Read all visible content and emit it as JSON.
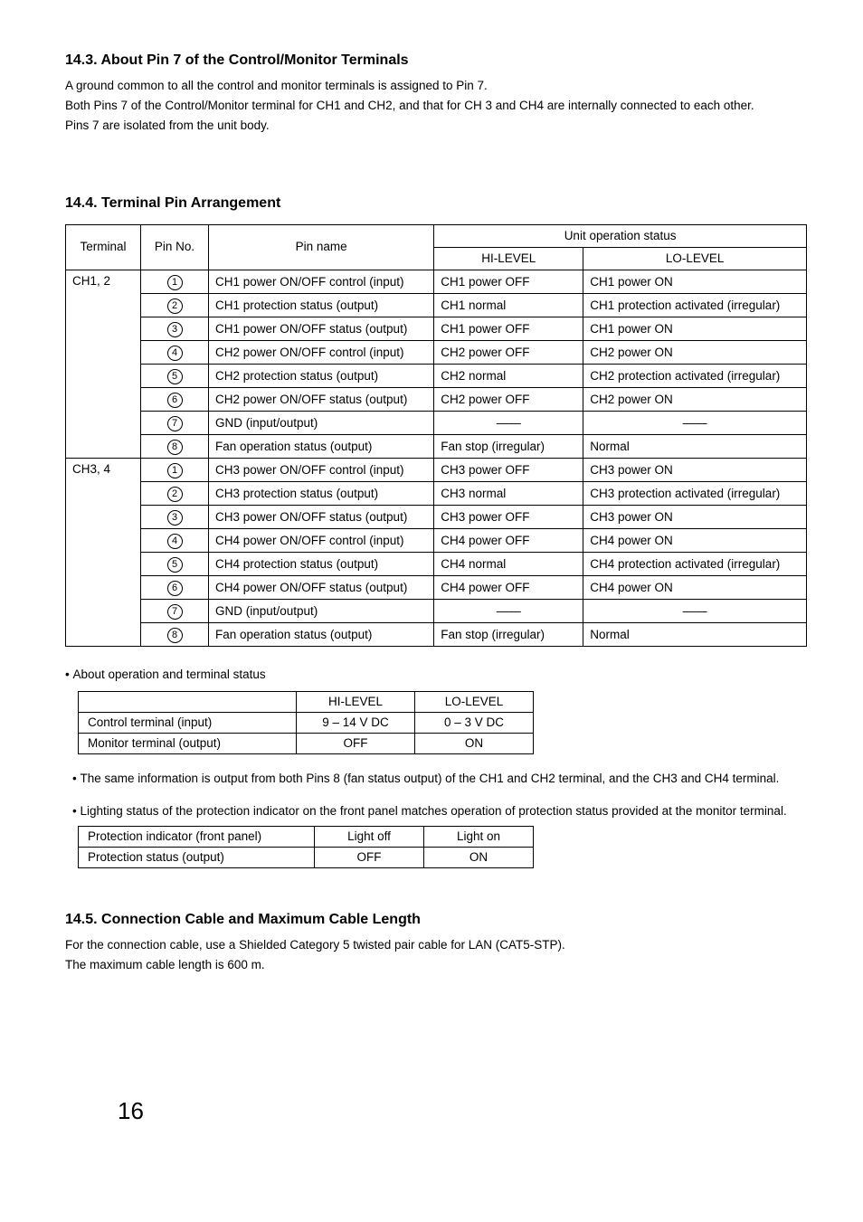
{
  "s1": {
    "heading": "14.3. About Pin 7 of the Control/Monitor Terminals",
    "p1": "A ground common to all the control and monitor terminals is assigned to Pin 7.",
    "p2": "Both Pins 7 of the Control/Monitor terminal for CH1 and CH2, and that for CH 3 and CH4 are internally connected to each other.",
    "p3": "Pins 7 are isolated from the unit body."
  },
  "s2": {
    "heading": "14.4. Terminal Pin Arrangement",
    "hdr": {
      "terminal": "Terminal",
      "pinno": "Pin No.",
      "pinname": "Pin name",
      "status": "Unit operation status",
      "hi": "HI-LEVEL",
      "lo": "LO-LEVEL"
    },
    "g1": "CH1, 2",
    "g2": "CH3, 4",
    "rows1": [
      {
        "n": "1",
        "name": "CH1 power ON/OFF control (input)",
        "hi": "CH1 power OFF",
        "lo": "CH1 power ON"
      },
      {
        "n": "2",
        "name": "CH1 protection status (output)",
        "hi": "CH1 normal",
        "lo": "CH1 protection activated (irregular)"
      },
      {
        "n": "3",
        "name": "CH1 power ON/OFF status (output)",
        "hi": "CH1 power OFF",
        "lo": "CH1 power ON"
      },
      {
        "n": "4",
        "name": "CH2 power ON/OFF control (input)",
        "hi": "CH2 power OFF",
        "lo": "CH2 power ON"
      },
      {
        "n": "5",
        "name": "CH2 protection status (output)",
        "hi": "CH2 normal",
        "lo": "CH2 protection activated (irregular)"
      },
      {
        "n": "6",
        "name": "CH2 power ON/OFF status (output)",
        "hi": "CH2 power OFF",
        "lo": "CH2 power ON"
      },
      {
        "n": "7",
        "name": "GND (input/output)",
        "hi": "——",
        "lo": "——"
      },
      {
        "n": "8",
        "name": "Fan operation status (output)",
        "hi": "Fan stop (irregular)",
        "lo": "Normal"
      }
    ],
    "rows2": [
      {
        "n": "1",
        "name": "CH3 power ON/OFF control (input)",
        "hi": "CH3 power OFF",
        "lo": "CH3 power ON"
      },
      {
        "n": "2",
        "name": "CH3 protection status (output)",
        "hi": "CH3 normal",
        "lo": "CH3 protection activated (irregular)"
      },
      {
        "n": "3",
        "name": "CH3 power ON/OFF status (output)",
        "hi": "CH3 power OFF",
        "lo": "CH3 power ON"
      },
      {
        "n": "4",
        "name": "CH4 power ON/OFF control (input)",
        "hi": "CH4 power OFF",
        "lo": "CH4 power ON"
      },
      {
        "n": "5",
        "name": "CH4 protection status (output)",
        "hi": "CH4 normal",
        "lo": "CH4 protection activated (irregular)"
      },
      {
        "n": "6",
        "name": "CH4 power ON/OFF status (output)",
        "hi": "CH4 power OFF",
        "lo": "CH4 power ON"
      },
      {
        "n": "7",
        "name": "GND (input/output)",
        "hi": "——",
        "lo": "——"
      },
      {
        "n": "8",
        "name": "Fan operation status (output)",
        "hi": "Fan stop (irregular)",
        "lo": "Normal"
      }
    ]
  },
  "note1": {
    "text": "About operation and terminal status",
    "hdr": {
      "blank": "",
      "hi": "HI-LEVEL",
      "lo": "LO-LEVEL"
    },
    "r1": {
      "label": "Control terminal (input)",
      "hi": "9 – 14 V DC",
      "lo": "0 – 3 V DC"
    },
    "r2": {
      "label": "Monitor terminal (output)",
      "hi": "OFF",
      "lo": "ON"
    }
  },
  "note2": "The same information is output from both Pins 8 (fan status output) of the CH1 and CH2 terminal, and the CH3 and CH4 terminal.",
  "note3": {
    "text": "Lighting status of the protection indicator on the front panel matches operation of protection status provided at the monitor terminal.",
    "hdr": {
      "a": "Protection indicator (front panel)",
      "b": "Light off",
      "c": "Light on"
    },
    "r1": {
      "a": "Protection status (output)",
      "b": "OFF",
      "c": "ON"
    }
  },
  "s3": {
    "heading": "14.5. Connection Cable and Maximum Cable Length",
    "p1": "For the connection cable, use a Shielded Category 5 twisted pair cable for LAN (CAT5-STP).",
    "p2": "The maximum cable length is 600 m."
  },
  "page": "16"
}
